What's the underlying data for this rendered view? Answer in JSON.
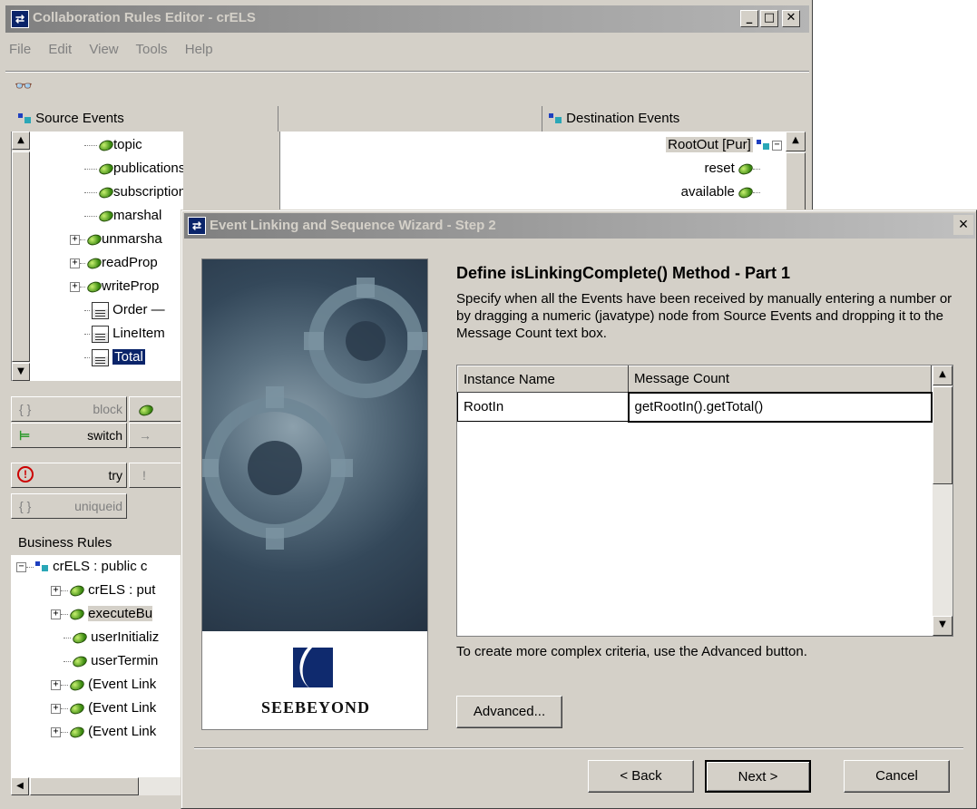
{
  "main_window": {
    "title": "Collaboration Rules Editor - crELS",
    "menu": [
      "File",
      "Edit",
      "View",
      "Tools",
      "Help"
    ],
    "source_header": "Source Events",
    "destination_header": "Destination Events",
    "source_items": [
      "topic",
      "publications",
      "subscriptions",
      "marshal",
      "unmarsha",
      "readProp",
      "writeProp",
      "Order —",
      "LineItem",
      "Total"
    ],
    "destination_items": [
      "RootOut [Pur]",
      "reset",
      "available"
    ],
    "blocks": {
      "block": "block",
      "switch": "switch",
      "try": "try",
      "uniqueid": "uniqueid",
      "arrow": "→",
      "bang": "!"
    },
    "business_rules_header": "Business Rules",
    "business_rules": [
      "crELS : public c",
      "crELS : put",
      "executeBu",
      "userInitializ",
      "userTermin",
      "(Event Link",
      "(Event Link",
      "(Event Link"
    ]
  },
  "dialog": {
    "title": "Event Linking and Sequence Wizard - Step 2",
    "close_glyph": "×",
    "heading": "Define isLinkingComplete() Method - Part 1",
    "description": "Specify when all the Events have been received by manually entering a number or by dragging a numeric (javatype) node from Source Events and dropping it to the Message Count text box.",
    "columns": [
      "Instance Name",
      "Message Count"
    ],
    "rows": [
      [
        "RootIn",
        "getRootIn().getTotal()"
      ]
    ],
    "hint": "To create more complex criteria, use the Advanced button.",
    "advanced_label": "Advanced...",
    "back_label": "< Back",
    "next_label": "Next >",
    "cancel_label": "Cancel",
    "logo_text": "SeeBeyond"
  }
}
